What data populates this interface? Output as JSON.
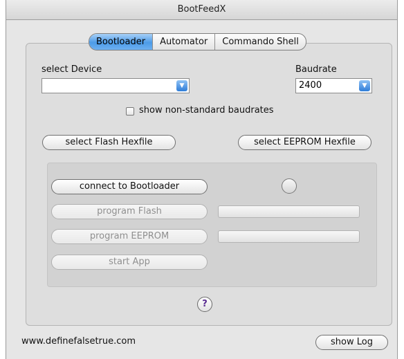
{
  "window": {
    "title": "BootFeedX"
  },
  "tabs": [
    {
      "label": "Bootloader",
      "active": true
    },
    {
      "label": "Automator",
      "active": false
    },
    {
      "label": "Commando Shell",
      "active": false
    }
  ],
  "device": {
    "label": "select Device",
    "value": ""
  },
  "baudrate": {
    "label": "Baudrate",
    "value": "2400"
  },
  "nonstandard": {
    "label": "show non-standard baudrates",
    "checked": false
  },
  "buttons": {
    "select_flash": "select Flash Hexfile",
    "select_eeprom": "select EEPROM Hexfile",
    "connect": "connect to Bootloader",
    "program_flash": "program Flash",
    "program_eeprom": "program EEPROM",
    "start_app": "start App",
    "help": "?",
    "show_log": "show Log"
  },
  "footer": {
    "website": "www.definefalsetrue.com"
  },
  "colors": {
    "tab_active": "#4c9be8",
    "help_glyph": "#5a2c91"
  },
  "icons": {
    "combo_arrow": "chevron-down-icon",
    "status": "status-indicator-icon",
    "help": "help-icon"
  }
}
